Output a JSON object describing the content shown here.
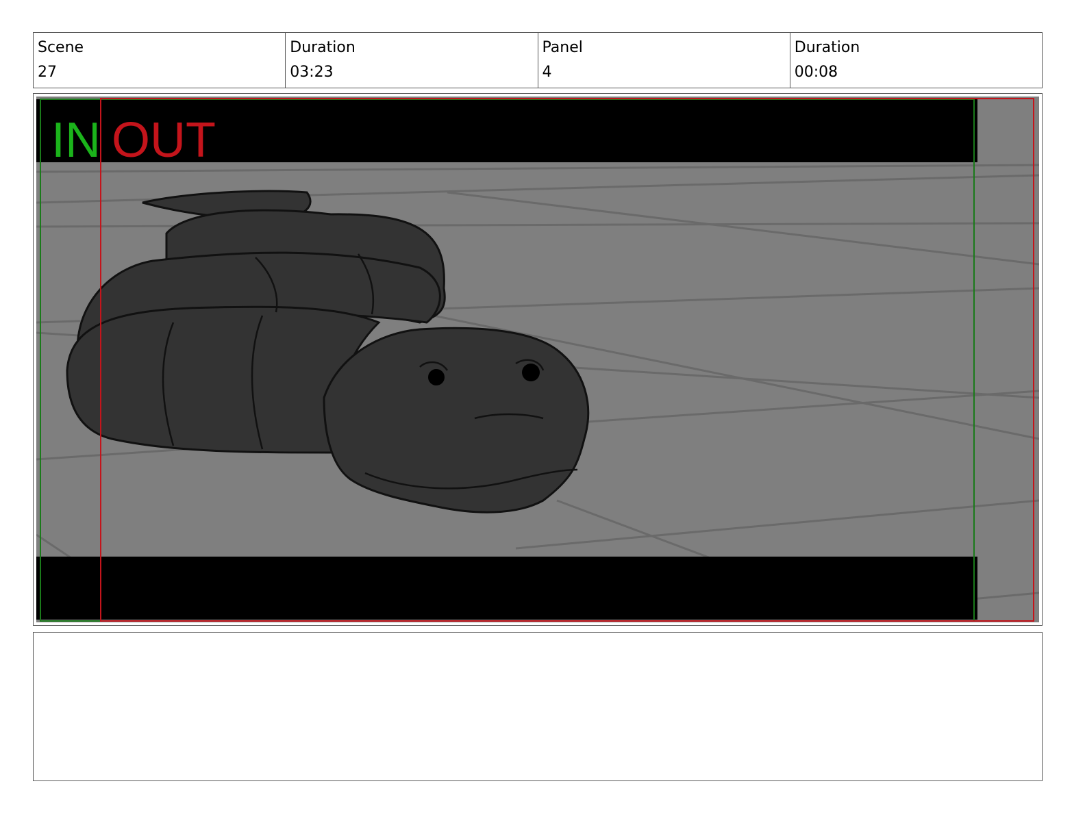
{
  "header": {
    "cells": [
      {
        "label": "Scene",
        "value": "27"
      },
      {
        "label": "Duration",
        "value": "03:23"
      },
      {
        "label": "Panel",
        "value": "4"
      },
      {
        "label": "Duration",
        "value": "00:08"
      }
    ]
  },
  "panel": {
    "in_label": "IN",
    "out_label": "OUT",
    "colors": {
      "in_marker": "#1bb41b",
      "out_marker": "#c4141b",
      "letterbox": "#000000",
      "background": "#7f7f7f",
      "subject": "#333333"
    }
  },
  "notes": {
    "text": ""
  }
}
